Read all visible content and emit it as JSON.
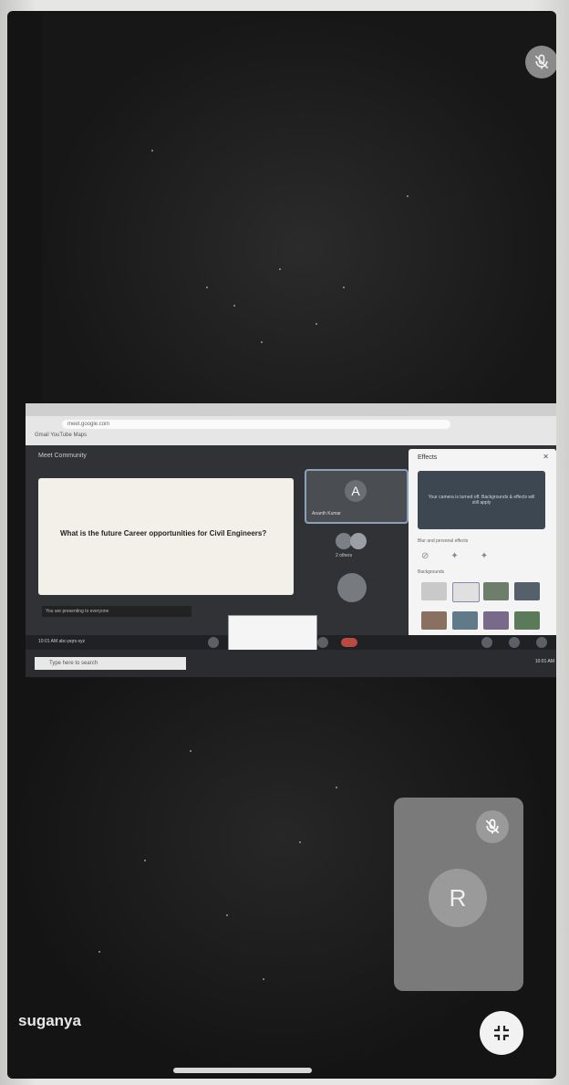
{
  "top_tile": {
    "mic_icon": "mic-off-icon"
  },
  "shared_screen": {
    "browser_url": "meet.google.com",
    "bookmarks": "Gmail   YouTube   Maps",
    "meeting_title": "Meet Community",
    "slide_question": "What is the future Career opportunities for Civil Engineers?",
    "slide_caption": "You are presenting to everyone",
    "presenter_initial": "A",
    "presenter_name": "Ananth Kumar",
    "others_label": "2 others",
    "effects_title": "Effects",
    "effects_preview_text": "Your camera is turned off. Backgrounds & effects will still apply",
    "effects_section_blur": "Blur and personal effects",
    "effects_section_backgrounds": "Backgrounds",
    "meeting_time": "10:01 AM   abc-pqrs-xyz",
    "taskbar_search": "Type here to search",
    "taskbar_clock": "10:01 AM"
  },
  "bottom_tile": {
    "speaker_name": "suganya",
    "self_view_initial": "R",
    "self_view_mic_icon": "mic-off-icon",
    "fullscreen_icon": "exit-fullscreen-icon"
  }
}
